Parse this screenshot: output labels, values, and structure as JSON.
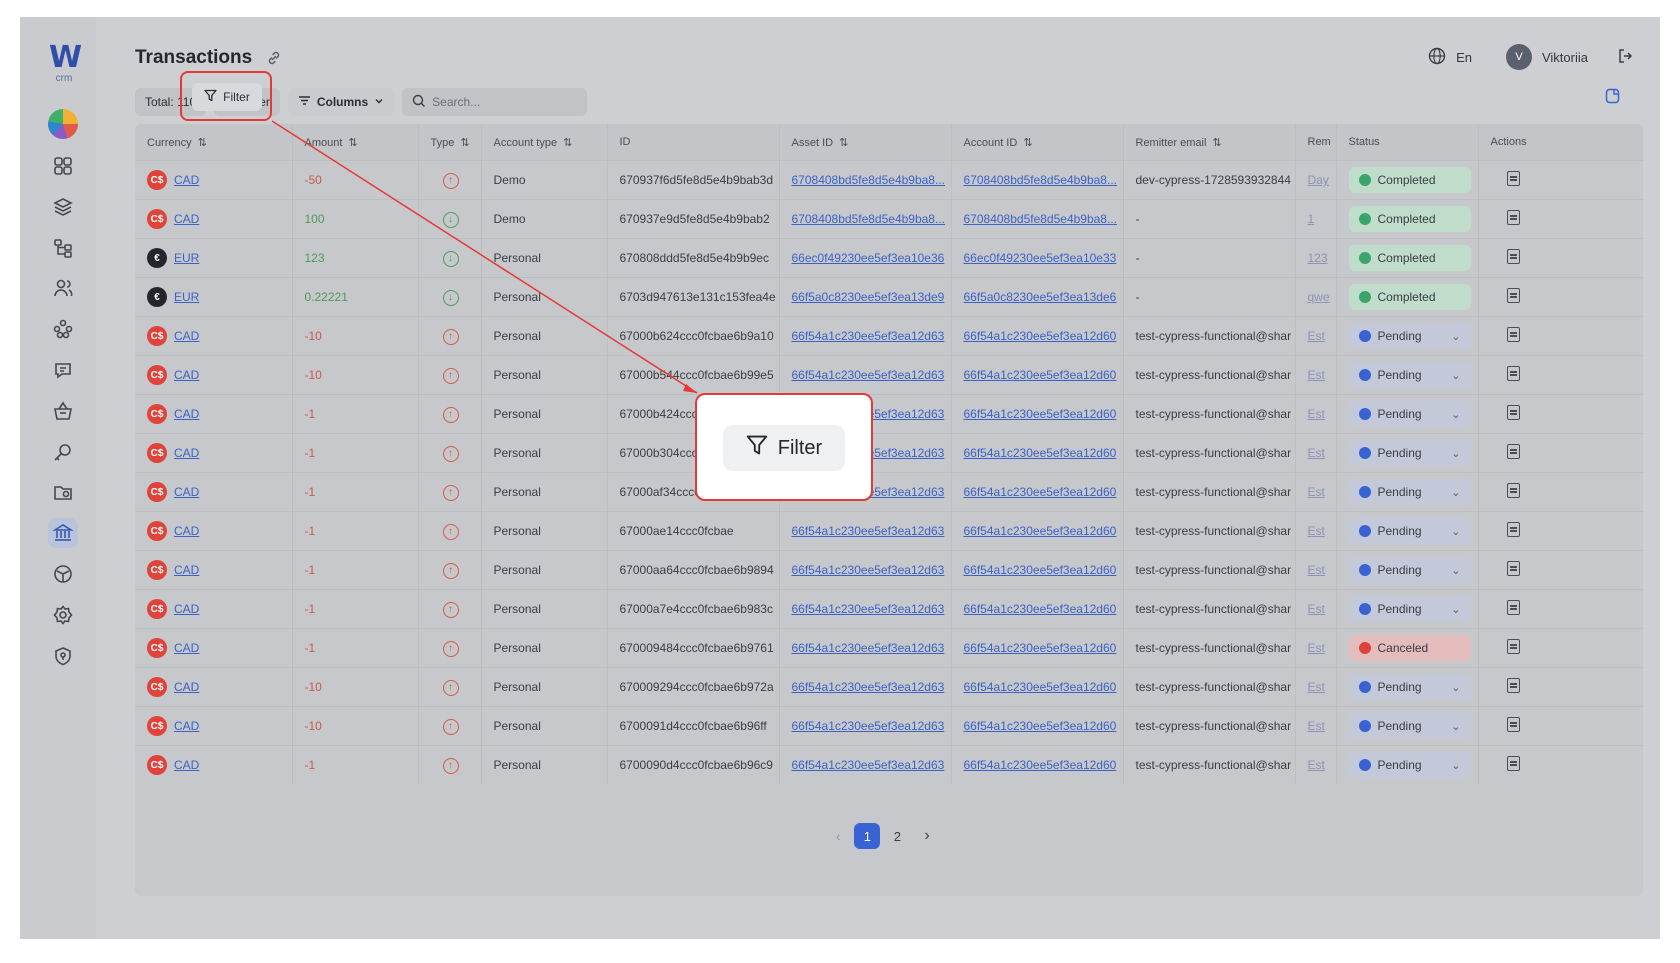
{
  "app": {
    "logo_letter": "W",
    "logo_sub": "crm",
    "title": "Transactions"
  },
  "header": {
    "language": "En",
    "user_initial": "V",
    "user_name": "Viktoriia"
  },
  "toolbar": {
    "total_label": "Total: 110",
    "filter_label": "Filter",
    "columns_label": "Columns",
    "search_placeholder": "Search..."
  },
  "sidebar": {
    "items": [
      {
        "icon": "dashboard-grid-icon"
      },
      {
        "icon": "layers-icon"
      },
      {
        "icon": "hierarchy-icon"
      },
      {
        "icon": "users-icon"
      },
      {
        "icon": "network-icon"
      },
      {
        "icon": "chat-icon"
      },
      {
        "icon": "basket-icon"
      },
      {
        "icon": "key-icon"
      },
      {
        "icon": "folder-icon"
      },
      {
        "icon": "bank-icon",
        "active": true
      },
      {
        "icon": "cube-icon"
      },
      {
        "icon": "settings-icon"
      },
      {
        "icon": "shield-icon"
      }
    ]
  },
  "table": {
    "columns": [
      "Currency",
      "Amount",
      "Type",
      "Account type",
      "ID",
      "Asset ID",
      "Account ID",
      "Remitter email",
      "Rem",
      "Status",
      "Actions"
    ],
    "rows": [
      {
        "currency": "CAD",
        "currency_symbol": "C$",
        "amount": "-50",
        "dir": "out",
        "account_type": "Demo",
        "id": "670937f6d5fe8d5e4b9bab3d",
        "asset_id": "6708408bd5fe8d5e4b9ba8...",
        "account_id": "6708408bd5fe8d5e4b9ba8...",
        "remitter_email": "dev-cypress-1728593932844",
        "rem": "Day",
        "status": "Completed"
      },
      {
        "currency": "CAD",
        "currency_symbol": "C$",
        "amount": "100",
        "dir": "in",
        "account_type": "Demo",
        "id": "670937e9d5fe8d5e4b9bab2",
        "asset_id": "6708408bd5fe8d5e4b9ba8...",
        "account_id": "6708408bd5fe8d5e4b9ba8...",
        "remitter_email": "-",
        "rem": "1",
        "status": "Completed"
      },
      {
        "currency": "EUR",
        "currency_symbol": "€",
        "amount": "123",
        "dir": "in",
        "account_type": "Personal",
        "id": "670808ddd5fe8d5e4b9b9ec",
        "asset_id": "66ec0f49230ee5ef3ea10e36",
        "account_id": "66ec0f49230ee5ef3ea10e33",
        "remitter_email": "-",
        "rem": "123",
        "status": "Completed"
      },
      {
        "currency": "EUR",
        "currency_symbol": "€",
        "amount": "0.22221",
        "dir": "in",
        "account_type": "Personal",
        "id": "6703d947613e131c153fea4e",
        "asset_id": "66f5a0c8230ee5ef3ea13de9",
        "account_id": "66f5a0c8230ee5ef3ea13de6",
        "remitter_email": "-",
        "rem": "qwe",
        "status": "Completed"
      },
      {
        "currency": "CAD",
        "currency_symbol": "C$",
        "amount": "-10",
        "dir": "out",
        "account_type": "Personal",
        "id": "67000b624ccc0fcbae6b9a10",
        "asset_id": "66f54a1c230ee5ef3ea12d63",
        "account_id": "66f54a1c230ee5ef3ea12d60",
        "remitter_email": "test-cypress-functional@shar",
        "rem": "Est",
        "status": "Pending"
      },
      {
        "currency": "CAD",
        "currency_symbol": "C$",
        "amount": "-10",
        "dir": "out",
        "account_type": "Personal",
        "id": "67000b544ccc0fcbae6b99e5",
        "asset_id": "66f54a1c230ee5ef3ea12d63",
        "account_id": "66f54a1c230ee5ef3ea12d60",
        "remitter_email": "test-cypress-functional@shar",
        "rem": "Est",
        "status": "Pending"
      },
      {
        "currency": "CAD",
        "currency_symbol": "C$",
        "amount": "-1",
        "dir": "out",
        "account_type": "Personal",
        "id": "67000b424ccc0fcbae6b99af",
        "asset_id": "66f54a1c230ee5ef3ea12d63",
        "account_id": "66f54a1c230ee5ef3ea12d60",
        "remitter_email": "test-cypress-functional@shar",
        "rem": "Est",
        "status": "Pending"
      },
      {
        "currency": "CAD",
        "currency_symbol": "C$",
        "amount": "-1",
        "dir": "out",
        "account_type": "Personal",
        "id": "67000b304ccc0fcba",
        "asset_id": "66f54a1c230ee5ef3ea12d63",
        "account_id": "66f54a1c230ee5ef3ea12d60",
        "remitter_email": "test-cypress-functional@shar",
        "rem": "Est",
        "status": "Pending"
      },
      {
        "currency": "CAD",
        "currency_symbol": "C$",
        "amount": "-1",
        "dir": "out",
        "account_type": "Personal",
        "id": "67000af34ccc0fcbae",
        "asset_id": "66f54a1c230ee5ef3ea12d63",
        "account_id": "66f54a1c230ee5ef3ea12d60",
        "remitter_email": "test-cypress-functional@shar",
        "rem": "Est",
        "status": "Pending"
      },
      {
        "currency": "CAD",
        "currency_symbol": "C$",
        "amount": "-1",
        "dir": "out",
        "account_type": "Personal",
        "id": "67000ae14ccc0fcbae",
        "asset_id": "66f54a1c230ee5ef3ea12d63",
        "account_id": "66f54a1c230ee5ef3ea12d60",
        "remitter_email": "test-cypress-functional@shar",
        "rem": "Est",
        "status": "Pending"
      },
      {
        "currency": "CAD",
        "currency_symbol": "C$",
        "amount": "-1",
        "dir": "out",
        "account_type": "Personal",
        "id": "67000aa64ccc0fcbae6b9894",
        "asset_id": "66f54a1c230ee5ef3ea12d63",
        "account_id": "66f54a1c230ee5ef3ea12d60",
        "remitter_email": "test-cypress-functional@shar",
        "rem": "Est",
        "status": "Pending"
      },
      {
        "currency": "CAD",
        "currency_symbol": "C$",
        "amount": "-1",
        "dir": "out",
        "account_type": "Personal",
        "id": "67000a7e4ccc0fcbae6b983c",
        "asset_id": "66f54a1c230ee5ef3ea12d63",
        "account_id": "66f54a1c230ee5ef3ea12d60",
        "remitter_email": "test-cypress-functional@shar",
        "rem": "Est",
        "status": "Pending"
      },
      {
        "currency": "CAD",
        "currency_symbol": "C$",
        "amount": "-1",
        "dir": "out",
        "account_type": "Personal",
        "id": "670009484ccc0fcbae6b9761",
        "asset_id": "66f54a1c230ee5ef3ea12d63",
        "account_id": "66f54a1c230ee5ef3ea12d60",
        "remitter_email": "test-cypress-functional@shar",
        "rem": "Est",
        "status": "Canceled"
      },
      {
        "currency": "CAD",
        "currency_symbol": "C$",
        "amount": "-10",
        "dir": "out",
        "account_type": "Personal",
        "id": "670009294ccc0fcbae6b972a",
        "asset_id": "66f54a1c230ee5ef3ea12d63",
        "account_id": "66f54a1c230ee5ef3ea12d60",
        "remitter_email": "test-cypress-functional@shar",
        "rem": "Est",
        "status": "Pending"
      },
      {
        "currency": "CAD",
        "currency_symbol": "C$",
        "amount": "-10",
        "dir": "out",
        "account_type": "Personal",
        "id": "6700091d4ccc0fcbae6b96ff",
        "asset_id": "66f54a1c230ee5ef3ea12d63",
        "account_id": "66f54a1c230ee5ef3ea12d60",
        "remitter_email": "test-cypress-functional@shar",
        "rem": "Est",
        "status": "Pending"
      },
      {
        "currency": "CAD",
        "currency_symbol": "C$",
        "amount": "-1",
        "dir": "out",
        "account_type": "Personal",
        "id": "6700090d4ccc0fcbae6b96c9",
        "asset_id": "66f54a1c230ee5ef3ea12d63",
        "account_id": "66f54a1c230ee5ef3ea12d60",
        "remitter_email": "test-cypress-functional@shar",
        "rem": "Est",
        "status": "Pending"
      }
    ]
  },
  "pagination": {
    "pages": [
      "1",
      "2"
    ],
    "current": "1"
  },
  "highlight": {
    "label": "Filter"
  },
  "colors": {
    "completed": "#3aa56a",
    "pending": "#3963d3",
    "canceled": "#d9433a",
    "cad": "#e0433a",
    "eur": "#23262b",
    "accent": "#3963d3",
    "annotation": "#e53935"
  }
}
